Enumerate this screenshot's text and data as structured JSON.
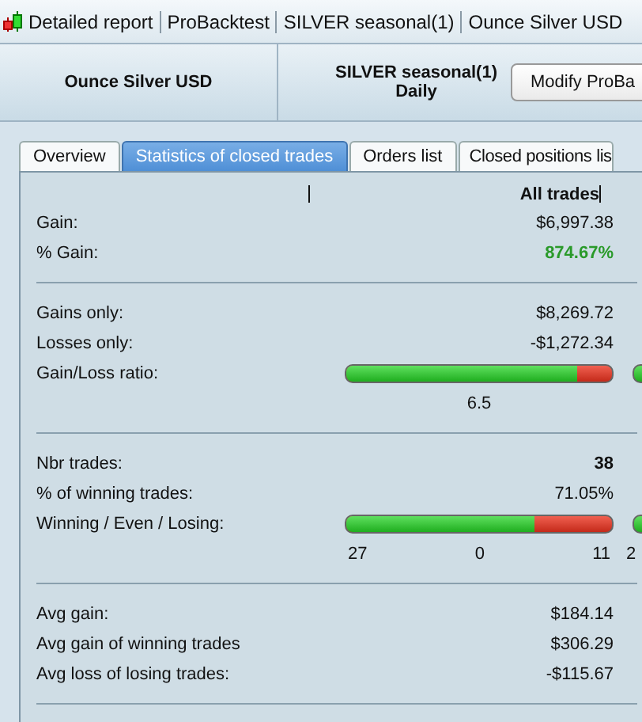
{
  "window": {
    "breadcrumbs": [
      "Detailed report",
      "ProBacktest",
      "SILVER seasonal(1)",
      "Ounce Silver USD"
    ]
  },
  "header": {
    "instrument": "Ounce Silver USD",
    "strategy": "SILVER seasonal(1)",
    "timeframe": "Daily",
    "button": "Modify ProBa"
  },
  "tabs": [
    {
      "label": "Overview",
      "selected": false
    },
    {
      "label": "Statistics of closed trades",
      "selected": true
    },
    {
      "label": "Orders list",
      "selected": false
    },
    {
      "label": "Closed positions lis",
      "selected": false
    }
  ],
  "table": {
    "column_1": "All trades",
    "sections": [
      {
        "rows": [
          {
            "kind": "value",
            "label": "Gain:",
            "value": "$6,997.38"
          },
          {
            "kind": "value",
            "label": "% Gain:",
            "value": "874.67%",
            "positive": true
          }
        ]
      },
      {
        "rows": [
          {
            "kind": "value",
            "label": "Gains only:",
            "value": "$8,269.72"
          },
          {
            "kind": "value",
            "label": "Losses only:",
            "value": "-$1,272.34"
          },
          {
            "kind": "bar",
            "label": "Gain/Loss ratio:",
            "level": 0.867,
            "ticks": [
              "6.5"
            ]
          }
        ]
      },
      {
        "rows": [
          {
            "kind": "value",
            "label": "Nbr trades:",
            "value": "38",
            "bold": true
          },
          {
            "kind": "value",
            "label": "% of winning trades:",
            "value": "71.05%"
          },
          {
            "kind": "bar",
            "label": "Winning / Even / Losing:",
            "level": 0.71,
            "ticks": [
              "27",
              "0",
              "11"
            ],
            "column_2_tick": "2"
          }
        ]
      },
      {
        "rows": [
          {
            "kind": "value",
            "label": "Avg gain:",
            "value": "$184.14"
          },
          {
            "kind": "value",
            "label": "Avg gain of winning trades",
            "value": "$306.29"
          },
          {
            "kind": "value",
            "label": "Avg loss of losing trades:",
            "value": "-$115.67"
          }
        ]
      }
    ]
  }
}
